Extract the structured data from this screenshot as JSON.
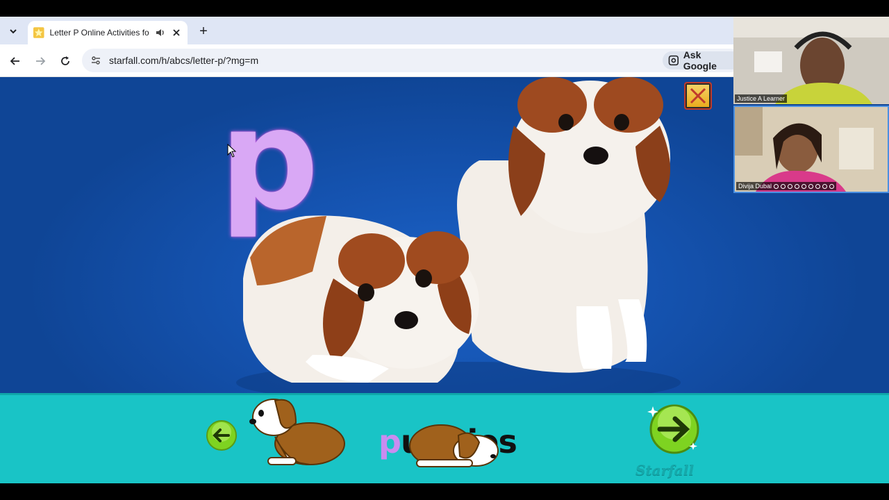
{
  "browser": {
    "tab_title": "Letter P Online Activities for",
    "new_tab_label": "+",
    "url": "starfall.com/h/abcs/letter-p/?mg=m",
    "ask_google_label": "Ask Google"
  },
  "page": {
    "big_letter": "p",
    "word_first_letter": "p",
    "word_rest": "uppies",
    "logo_text": "Starfall"
  },
  "video_call": {
    "participant_1": "Justice A Learner",
    "participant_2": "Divija Dubal"
  },
  "colors": {
    "photo_bg": "#1553b0",
    "band_bg": "#19c4c6",
    "letter": "#d9a8f5"
  }
}
